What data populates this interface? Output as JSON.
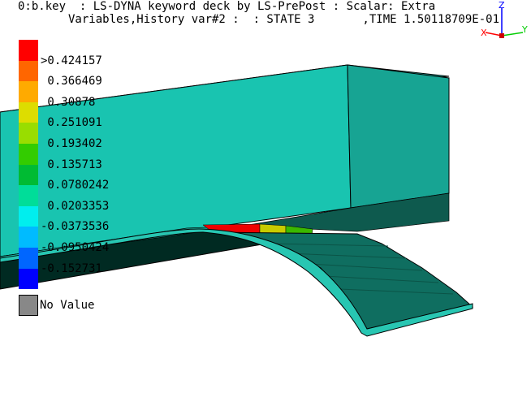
{
  "title": {
    "line1": "0:b.key  : LS-DYNA keyword deck by LS-PrePost : Scalar: Extra",
    "line2": "Variables,History var#2 :  : STATE 3       ,TIME 1.50118709E-01"
  },
  "legend": {
    "colors": [
      "#ff0000",
      "#ff6600",
      "#ffaa00",
      "#dddd00",
      "#99dd00",
      "#33cc00",
      "#00bb33",
      "#00dd99",
      "#00eeee",
      "#00bbff",
      "#0066ff",
      "#0000ff"
    ],
    "labels": [
      ">0.424157",
      " 0.366469",
      " 0.30878",
      " 0.251091",
      " 0.193402",
      " 0.135713",
      " 0.0780242",
      " 0.0203353",
      "-0.0373536",
      "-0.0950424",
      "-0.152731"
    ],
    "no_value_label": "No Value",
    "no_value_color": "#888888"
  },
  "triad": {
    "x_label": "X",
    "y_label": "Y",
    "z_label": "Z",
    "x_color": "#ff0000",
    "y_color": "#00cc00",
    "z_color": "#0000ff"
  }
}
